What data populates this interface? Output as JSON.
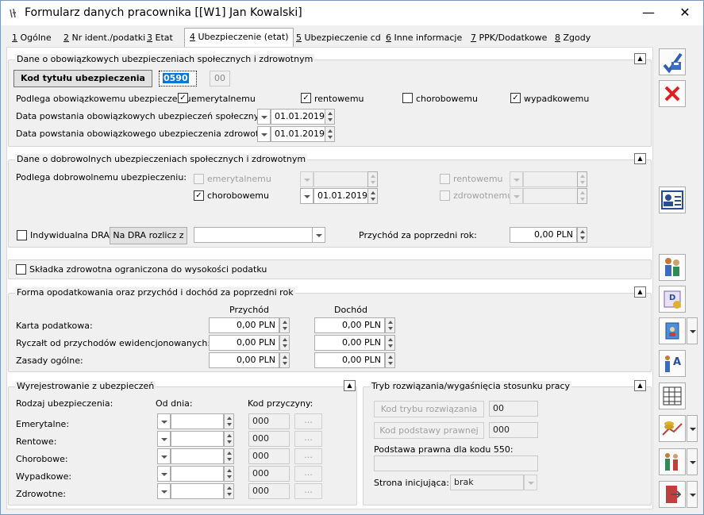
{
  "window": {
    "title": "Formularz danych pracownika [[W1] Jan Kowalski]",
    "minimize": "—",
    "close": "✕"
  },
  "tabs": [
    {
      "num": "1",
      "label": "Ogólne"
    },
    {
      "num": "2",
      "label": "Nr ident./podatki"
    },
    {
      "num": "3",
      "label": "Etat"
    },
    {
      "num": "4",
      "label": "Ubezpieczenie (etat)"
    },
    {
      "num": "5",
      "label": "Ubezpieczenie cd"
    },
    {
      "num": "6",
      "label": "Inne informacje"
    },
    {
      "num": "7",
      "label": "PPK/Dodatkowe"
    },
    {
      "num": "8",
      "label": "Zgody"
    }
  ],
  "obligatory": {
    "title": "Dane o obowiązkowych ubezpieczeniach społecznych i zdrowotnym",
    "code_button": "Kod tytułu ubezpieczenia",
    "code_value": "0590",
    "code_suffix": "00",
    "subject_label": "Podlega obowiązkowemu ubezpieczeniu:",
    "emerytalnemu": {
      "label": "emerytalnemu",
      "checked": true
    },
    "rentowemu": {
      "label": "rentowemu",
      "checked": true
    },
    "chorobowemu": {
      "label": "chorobowemu",
      "checked": false
    },
    "wypadkowemu": {
      "label": "wypadkowemu",
      "checked": true
    },
    "social_date_label": "Data powstania obowiązkowych ubezpieczeń społecznych:",
    "social_date": "01.01.2019",
    "health_date_label": "Data powstania obowiązkowego ubezpieczenia zdrowotnego:",
    "health_date": "01.01.2019"
  },
  "voluntary": {
    "title": "Dane o dobrowolnych ubezpieczeniach społecznych i zdrowotnym",
    "subject_label": "Podlega dobrowolnemu ubezpieczeniu:",
    "emerytalnemu": "emerytalnemu",
    "rentowemu": "rentowemu",
    "chorobowemu": "chorobowemu",
    "zdrowotnemu": "zdrowotnemu",
    "chorobowemu_date": "01.01.2019",
    "individual_dra": "Indywidualna DRA",
    "dra_button": "Na DRA rozlicz z",
    "prev_income_label": "Przychód za poprzedni rok:",
    "prev_income": "0,00 PLN"
  },
  "health_limit": {
    "label": "Składka zdrowotna ograniczona do wysokości podatku"
  },
  "taxation": {
    "title": "Forma opodatkowania oraz przychód i dochód za poprzedni rok",
    "col_income": "Przychód",
    "col_profit": "Dochód",
    "rows": [
      {
        "label": "Karta podatkowa:",
        "income": "0,00 PLN",
        "profit": "0,00 PLN"
      },
      {
        "label": "Ryczałt od przychodów ewidencjonowanych:",
        "income": "0,00 PLN",
        "profit": "0,00 PLN"
      },
      {
        "label": "Zasady ogólne:",
        "income": "0,00 PLN",
        "profit": "0,00 PLN"
      }
    ]
  },
  "deregistration": {
    "title": "Wyrejestrowanie z ubezpieczeń",
    "type_label": "Rodzaj ubezpieczenia:",
    "from_label": "Od dnia:",
    "reason_label": "Kod przyczyny:",
    "rows": [
      {
        "label": "Emerytalne:",
        "code": "000"
      },
      {
        "label": "Rentowe:",
        "code": "000"
      },
      {
        "label": "Chorobowe:",
        "code": "000"
      },
      {
        "label": "Wypadkowe:",
        "code": "000"
      },
      {
        "label": "Zdrowotne:",
        "code": "000"
      }
    ],
    "more": "..."
  },
  "termination": {
    "title": "Tryb rozwiązania/wygaśnięcia stosunku pracy",
    "mode_button": "Kod trybu rozwiązania",
    "mode_value": "00",
    "legal_button": "Kod podstawy prawnej",
    "legal_value": "000",
    "legal550_label": "Podstawa prawna dla kodu 550:",
    "initiator_label": "Strona inicjująca:",
    "initiator_value": "brak"
  }
}
